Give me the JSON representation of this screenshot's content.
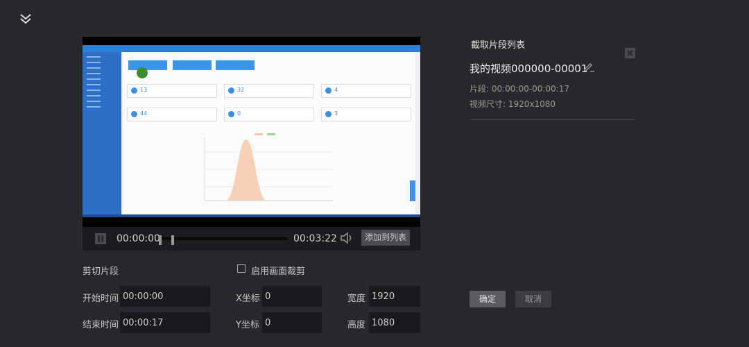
{
  "player": {
    "current_time": "00:00:00",
    "duration": "00:03:22",
    "add_to_list_label": "添加到列表",
    "progress": 0
  },
  "clip_section": {
    "title": "剪切片段",
    "start_label": "开始时间",
    "start_value": "00:00:00",
    "end_label": "结束时间",
    "end_value": "00:00:17"
  },
  "crop_section": {
    "enable_label": "启用画面裁剪",
    "enabled": false,
    "x_label": "X坐标",
    "x_value": "0",
    "y_label": "Y坐标",
    "y_value": "0",
    "width_label": "宽度",
    "width_value": "1920",
    "height_label": "高度",
    "height_value": "1080"
  },
  "clip_list": {
    "title": "截取片段列表",
    "item": {
      "name": "我的视频000000-00001",
      "segment": "片段: 00:00:00-00:00:17",
      "size": "视频尺寸: 1920x1080"
    }
  },
  "actions": {
    "ok_label": "确定",
    "cancel_label": "取消"
  },
  "icons": {
    "collapse": "double-chevron-down-icon",
    "pause": "pause-icon",
    "volume": "speaker-icon",
    "close": "close-icon",
    "edit": "pencil-icon"
  }
}
